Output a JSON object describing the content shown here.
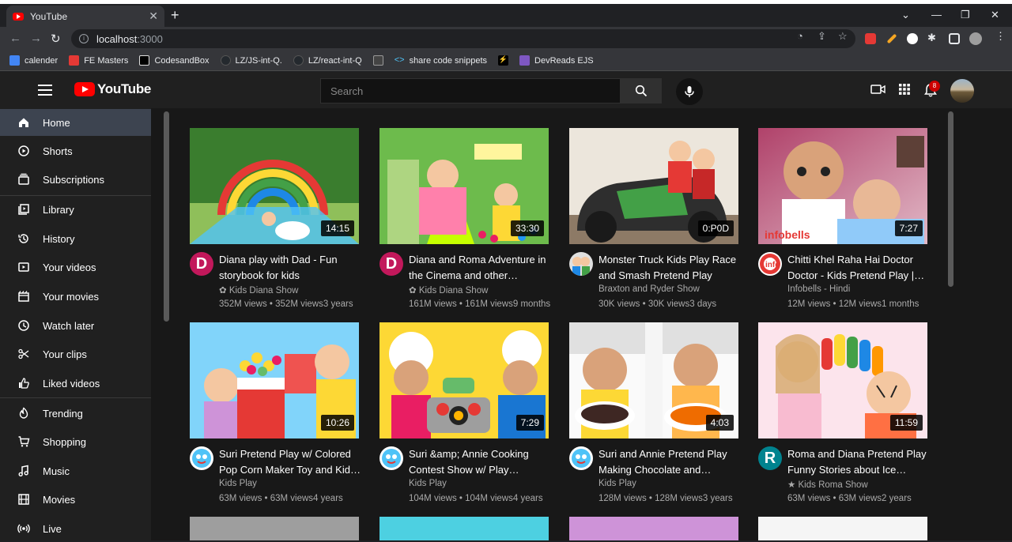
{
  "browser": {
    "tab_title": "YouTube",
    "address_host": "localhost",
    "address_port": ":3000",
    "bookmarks": [
      {
        "label": "calender",
        "color": "#4285f4"
      },
      {
        "label": "FE Masters",
        "color": "#e53935"
      },
      {
        "label": "CodesandBox",
        "color": "#000000"
      },
      {
        "label": "LZ/JS-int-Q.",
        "color": "#24292e"
      },
      {
        "label": "LZ/react-int-Q",
        "color": "#24292e"
      },
      {
        "label": "",
        "color": "#444444"
      },
      {
        "label": "share code snippets",
        "color": "#1e88e5"
      },
      {
        "label": "",
        "color": "#000000"
      },
      {
        "label": "DevReads EJS",
        "color": "#7e57c2"
      }
    ]
  },
  "header": {
    "logo_text": "YouTube",
    "search_placeholder": "Search",
    "notification_count": "8"
  },
  "sidebar": {
    "items": [
      {
        "label": "Home",
        "icon": "home-icon"
      },
      {
        "label": "Shorts",
        "icon": "shorts-icon"
      },
      {
        "label": "Subscriptions",
        "icon": "subscriptions-icon"
      },
      {
        "label": "Library",
        "icon": "library-icon"
      },
      {
        "label": "History",
        "icon": "history-icon"
      },
      {
        "label": "Your videos",
        "icon": "your-videos-icon"
      },
      {
        "label": "Your movies",
        "icon": "your-movies-icon"
      },
      {
        "label": "Watch later",
        "icon": "watch-later-icon"
      },
      {
        "label": "Your clips",
        "icon": "clips-icon"
      },
      {
        "label": "Liked videos",
        "icon": "like-icon"
      },
      {
        "label": "Trending",
        "icon": "trending-icon"
      },
      {
        "label": "Shopping",
        "icon": "shopping-icon"
      },
      {
        "label": "Music",
        "icon": "music-icon"
      },
      {
        "label": "Movies",
        "icon": "movies-icon"
      },
      {
        "label": "Live",
        "icon": "live-icon"
      }
    ]
  },
  "videos": [
    {
      "title": "Diana play with Dad - Fun storybook for kids",
      "channel": "✿ Kids Diana Show",
      "views": "352M views • 352M views3 years",
      "duration": "14:15",
      "avatar": "D",
      "avatar_color": "#c2185b"
    },
    {
      "title": "Diana and Roma Adventure in the Cinema and other…",
      "channel": "✿ Kids Diana Show",
      "views": "161M views • 161M views9 months",
      "duration": "33:30",
      "avatar": "D",
      "avatar_color": "#c2185b"
    },
    {
      "title": "Monster Truck Kids Play Race and Smash Pretend Play",
      "channel": "Braxton and Ryder Show",
      "views": "30K views • 30K views3 days",
      "duration": "0:P0D",
      "avatar": "",
      "avatar_color": "#e0e0e0"
    },
    {
      "title": "Chitti Khel Raha Hai Doctor Doctor - Kids Pretend Play |…",
      "channel": "Infobells - Hindi",
      "views": "12M views • 12M views1 months",
      "duration": "7:27",
      "avatar": "",
      "avatar_color": "#ffffff"
    },
    {
      "title": "Suri Pretend Play w/ Colored Pop Corn Maker Toy and Kid…",
      "channel": "Kids Play",
      "views": "63M views • 63M views4 years",
      "duration": "10:26",
      "avatar": "",
      "avatar_color": "#ffffff"
    },
    {
      "title": "Suri &amp; Annie Cooking Contest Show w/ Play…",
      "channel": "Kids Play",
      "views": "104M views • 104M views4 years",
      "duration": "7:29",
      "avatar": "",
      "avatar_color": "#ffffff"
    },
    {
      "title": "Suri and Annie Pretend Play Making Chocolate and…",
      "channel": "Kids Play",
      "views": "128M views • 128M views3 years",
      "duration": "4:03",
      "avatar": "",
      "avatar_color": "#ffffff"
    },
    {
      "title": "Roma and Diana Pretend Play Funny Stories about Ice…",
      "channel": "★ Kids Roma Show",
      "views": "63M views • 63M views2 years",
      "duration": "11:59",
      "avatar": "R",
      "avatar_color": "#00838f"
    }
  ]
}
